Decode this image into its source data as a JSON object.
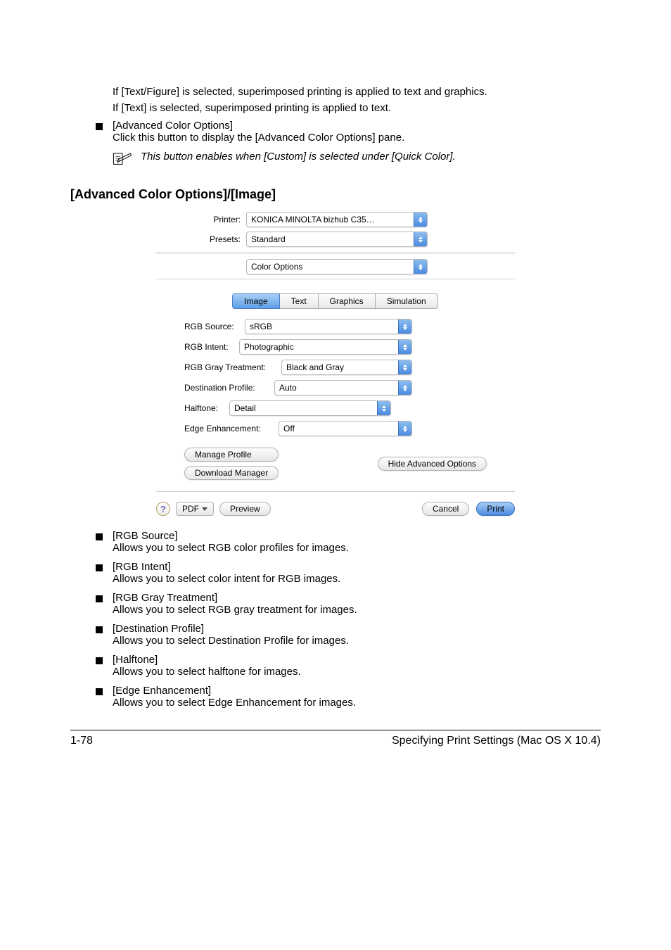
{
  "top": {
    "p1": "If [Text/Figure] is selected, superimposed printing is applied to text and graphics.",
    "p2": "If [Text] is selected, superimposed printing is applied to text.",
    "b1_title": "[Advanced Color Options]",
    "b1_body_a": "Click this button to display the",
    "b1_body_b": "[Advanced Color Options]",
    "b1_body_c": "pane.",
    "note": "This button enables when [Custom] is selected under [Quick Color]."
  },
  "heading": "[Advanced Color Options]/[Image]",
  "dialog": {
    "printer_label": "Printer:",
    "printer_value": "KONICA MINOLTA bizhub C35…",
    "presets_label": "Presets:",
    "presets_value": "Standard",
    "panel_value": "Color Options",
    "tabs": {
      "image": "Image",
      "text": "Text",
      "graphics": "Graphics",
      "simulation": "Simulation"
    },
    "rows": {
      "rgb_source_l": "RGB Source:",
      "rgb_source_v": "sRGB",
      "rgb_intent_l": "RGB Intent:",
      "rgb_intent_v": "Photographic",
      "rgb_gray_l": "RGB Gray Treatment:",
      "rgb_gray_v": "Black and Gray",
      "dest_l": "Destination Profile:",
      "dest_v": "Auto",
      "halftone_l": "Halftone:",
      "halftone_v": "Detail",
      "edge_l": "Edge Enhancement:",
      "edge_v": "Off"
    },
    "manage_profile": "Manage Profile",
    "download_manager": "Download Manager",
    "hide_adv": "Hide Advanced Options",
    "help": "?",
    "pdf": "PDF",
    "preview": "Preview",
    "cancel": "Cancel",
    "print": "Print"
  },
  "lower": {
    "b1_t": "[RGB Source]",
    "b1_d": "Allows you to select RGB color profiles for images.",
    "b2_t": "[RGB Intent]",
    "b2_d": "Allows you to select color intent for RGB images.",
    "b3_t": "[RGB Gray Treatment]",
    "b3_d": "Allows you to select RGB gray treatment for images.",
    "b4_t": "[Destination Profile]",
    "b4_d": "Allows you to select Destination Profile for images.",
    "b5_t": "[Halftone]",
    "b5_d": "Allows you to select halftone for images.",
    "b6_t": "[Edge Enhancement]",
    "b6_d": "Allows you to select Edge Enhancement for images."
  },
  "footer": {
    "page": "1-78",
    "title": "Specifying Print Settings (Mac OS X 10.4)"
  }
}
